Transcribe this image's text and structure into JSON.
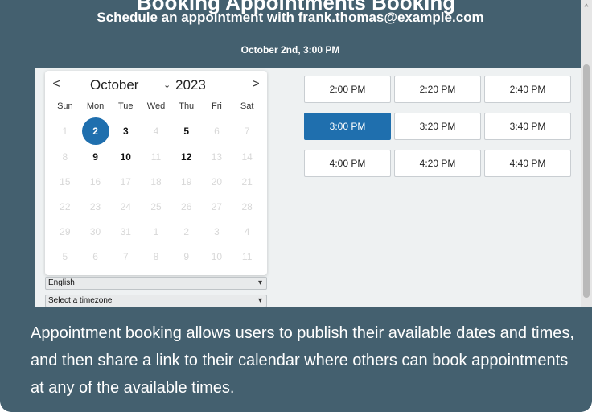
{
  "banner": {
    "title": "Booking Appointments Booking"
  },
  "header": {
    "title": "Schedule an appointment with frank.thomas@example.com",
    "selected_datetime": "October 2nd, 3:00 PM"
  },
  "calendar": {
    "prev_label": "<",
    "next_label": ">",
    "month": "October",
    "year": "2023",
    "weekdays": [
      "Sun",
      "Mon",
      "Tue",
      "Wed",
      "Thu",
      "Fri",
      "Sat"
    ],
    "days": [
      {
        "n": "1",
        "active": false
      },
      {
        "n": "2",
        "active": true,
        "selected": true
      },
      {
        "n": "3",
        "active": true
      },
      {
        "n": "4",
        "active": false
      },
      {
        "n": "5",
        "active": true
      },
      {
        "n": "6",
        "active": false
      },
      {
        "n": "7",
        "active": false
      },
      {
        "n": "8",
        "active": false
      },
      {
        "n": "9",
        "active": true
      },
      {
        "n": "10",
        "active": true
      },
      {
        "n": "11",
        "active": false
      },
      {
        "n": "12",
        "active": true
      },
      {
        "n": "13",
        "active": false
      },
      {
        "n": "14",
        "active": false
      },
      {
        "n": "15",
        "active": false
      },
      {
        "n": "16",
        "active": false
      },
      {
        "n": "17",
        "active": false
      },
      {
        "n": "18",
        "active": false
      },
      {
        "n": "19",
        "active": false
      },
      {
        "n": "20",
        "active": false
      },
      {
        "n": "21",
        "active": false
      },
      {
        "n": "22",
        "active": false
      },
      {
        "n": "23",
        "active": false
      },
      {
        "n": "24",
        "active": false
      },
      {
        "n": "25",
        "active": false
      },
      {
        "n": "26",
        "active": false
      },
      {
        "n": "27",
        "active": false
      },
      {
        "n": "28",
        "active": false
      },
      {
        "n": "29",
        "active": false
      },
      {
        "n": "30",
        "active": false
      },
      {
        "n": "31",
        "active": false
      },
      {
        "n": "1",
        "active": false
      },
      {
        "n": "2",
        "active": false
      },
      {
        "n": "3",
        "active": false
      },
      {
        "n": "4",
        "active": false
      },
      {
        "n": "5",
        "active": false
      },
      {
        "n": "6",
        "active": false
      },
      {
        "n": "7",
        "active": false
      },
      {
        "n": "8",
        "active": false
      },
      {
        "n": "9",
        "active": false
      },
      {
        "n": "10",
        "active": false
      },
      {
        "n": "11",
        "active": false
      }
    ]
  },
  "language_select": {
    "value": "English"
  },
  "timezone_select": {
    "value": "Select a timezone"
  },
  "time_slots": [
    {
      "label": "2:00 PM",
      "selected": false
    },
    {
      "label": "2:20 PM",
      "selected": false
    },
    {
      "label": "2:40 PM",
      "selected": false
    },
    {
      "label": "3:00 PM",
      "selected": true
    },
    {
      "label": "3:20 PM",
      "selected": false
    },
    {
      "label": "3:40 PM",
      "selected": false
    },
    {
      "label": "4:00 PM",
      "selected": false
    },
    {
      "label": "4:20 PM",
      "selected": false
    },
    {
      "label": "4:40 PM",
      "selected": false
    }
  ],
  "caption": "Appointment booking allows users to publish their available dates and times, and then share a link to their calendar where others can book appointments at any of the available times.",
  "colors": {
    "frame": "#44606f",
    "accent": "#1f6fae",
    "app_background": "#eef1f2"
  }
}
